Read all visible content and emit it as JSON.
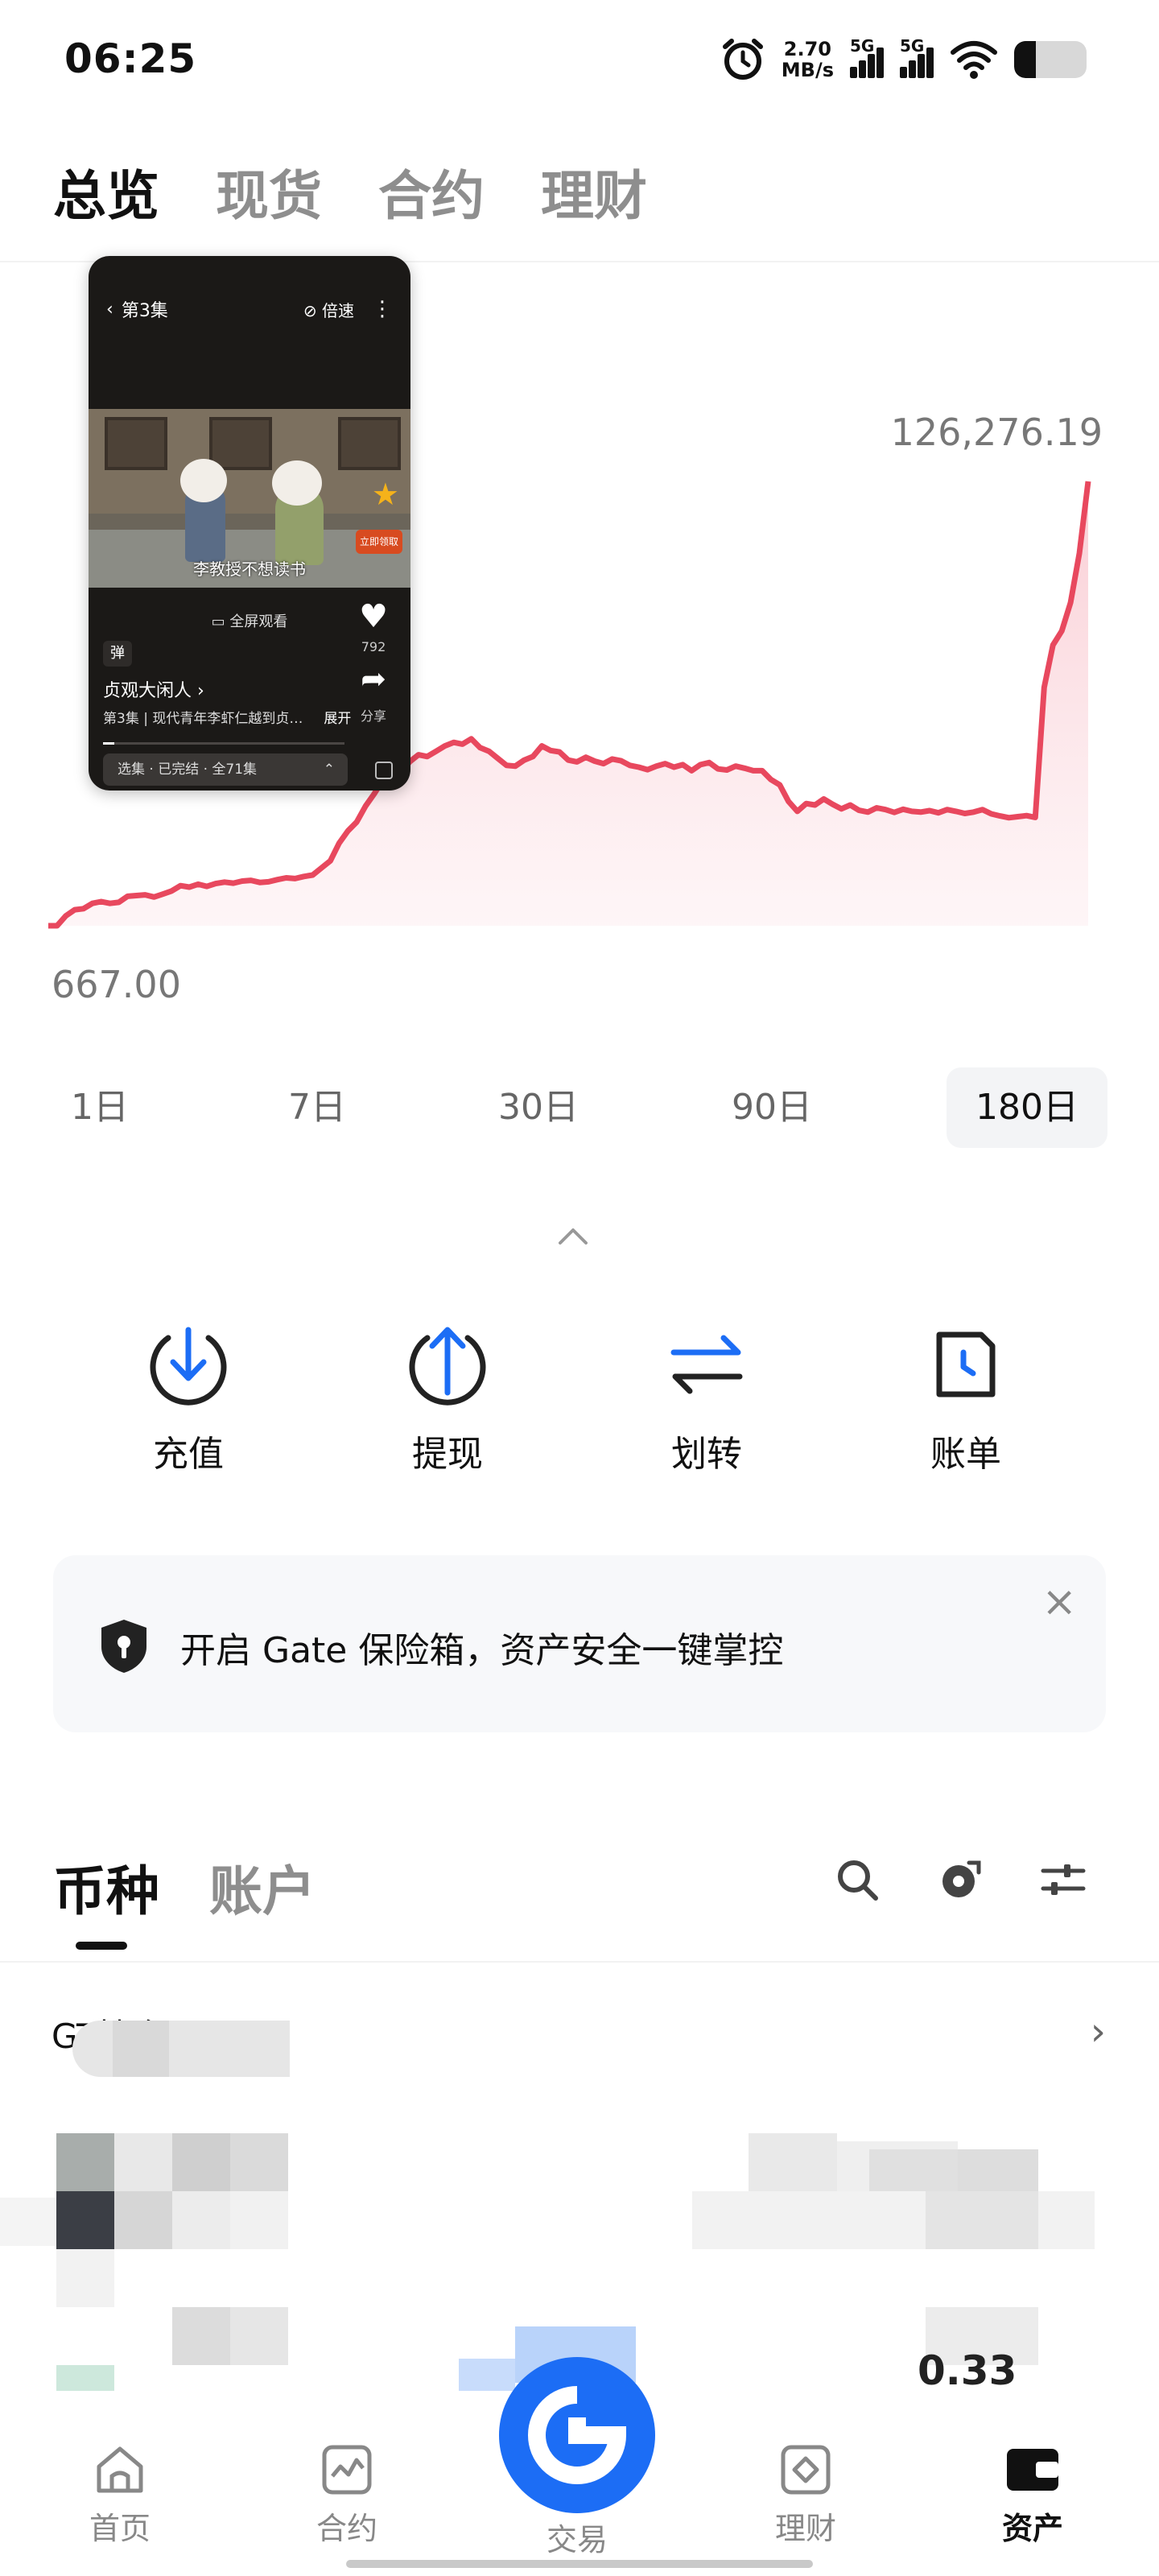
{
  "status_bar": {
    "time": "06:25",
    "speed_value": "2.70",
    "speed_unit": "MB/s",
    "sim1": "5G",
    "sim2": "5G",
    "icons": [
      "alarm-icon",
      "signal-icon",
      "wifi-icon",
      "battery-icon"
    ],
    "battery_level": 0.3
  },
  "top_tabs": [
    {
      "label": "总览",
      "active": true
    },
    {
      "label": "现货",
      "active": false
    },
    {
      "label": "合约",
      "active": false
    },
    {
      "label": "理财",
      "active": false
    }
  ],
  "chart_data": {
    "type": "area",
    "title": "",
    "xlabel": "",
    "ylabel": "",
    "max_label": "126,276.19",
    "min_label": "667.00",
    "ylim": [
      667.0,
      126276.19
    ],
    "color": "#e8485e",
    "fill_color": "#fde6ea",
    "series": [
      {
        "values": [
          667,
          667,
          3500,
          5200,
          5500,
          7000,
          7500,
          7000,
          7300,
          9000,
          9200,
          9400,
          8800,
          9600,
          10500,
          12000,
          11600,
          12400,
          11800,
          12600,
          13000,
          12700,
          13300,
          13500,
          12900,
          13100,
          13700,
          14200,
          14000,
          14600,
          15000,
          17000,
          19000,
          24000,
          27500,
          30000,
          34500,
          38000,
          42000,
          44500,
          43800,
          47000,
          49000,
          48500,
          50000,
          51500,
          52500,
          52000,
          53500,
          51000,
          50000,
          48000,
          46000,
          45800,
          47500,
          48500,
          51500,
          50200,
          49800,
          47500,
          47000,
          48300,
          47200,
          46500,
          47800,
          47300,
          46000,
          45500,
          44800,
          45800,
          46500,
          45500,
          46200,
          44500,
          46200,
          46800,
          45000,
          44700,
          45800,
          45200,
          44500,
          44500,
          42000,
          40500,
          35800,
          33000,
          35200,
          34800,
          36500,
          35000,
          33700,
          34800,
          33300,
          32800,
          34000,
          33500,
          32700,
          33600,
          33000,
          32800,
          33200,
          32600,
          33500,
          33000,
          32400,
          32800,
          33500,
          32300,
          31700,
          31200,
          31500,
          31800,
          31300,
          68000,
          80000,
          84000,
          92000,
          106000,
          126276.19
        ]
      }
    ]
  },
  "video_pip": {
    "episode_title": "第3集",
    "speed_label": "倍速",
    "subtitle": "李教授不想读书",
    "star_badge": "立即领取",
    "fullscreen_label": "全屏观看",
    "like_count": "792",
    "danmaku_label": "弹",
    "series_title": "贞观大闲人 ›",
    "share_label": "分享",
    "description": "第3集 | 现代青年李虾仁越到贞…",
    "expand_label": "展开",
    "episode_bar": "选集 · 已完结 · 全71集"
  },
  "range_tabs": [
    {
      "label": "1日",
      "active": false
    },
    {
      "label": "7日",
      "active": false
    },
    {
      "label": "30日",
      "active": false
    },
    {
      "label": "90日",
      "active": false
    },
    {
      "label": "180日",
      "active": true
    }
  ],
  "actions": [
    {
      "label": "充值",
      "icon": "deposit-icon"
    },
    {
      "label": "提现",
      "icon": "withdraw-icon"
    },
    {
      "label": "划转",
      "icon": "transfer-icon"
    },
    {
      "label": "账单",
      "icon": "bill-icon"
    }
  ],
  "banner": {
    "text": "开启 Gate 保险箱，资产安全一键掌控",
    "icon": "shield-icon",
    "close": "×"
  },
  "coin_tabs": [
    {
      "label": "币种",
      "active": true
    },
    {
      "label": "账户",
      "active": false
    }
  ],
  "coin_tools": [
    "search-icon",
    "hide-small-icon",
    "filter-icon"
  ],
  "gt_row": {
    "label": "GT持仓 0.00"
  },
  "obscured_value": "0.33",
  "bottom_nav": [
    {
      "label": "首页",
      "icon": "home-icon",
      "active": false
    },
    {
      "label": "合约",
      "icon": "futures-icon",
      "active": false
    },
    {
      "label": "交易",
      "icon": "trade-icon",
      "active": false
    },
    {
      "label": "理财",
      "icon": "earn-icon",
      "active": false
    },
    {
      "label": "资产",
      "icon": "wallet-icon",
      "active": true
    }
  ],
  "colors": {
    "accent": "#1c6df5",
    "chart_line": "#e8485e",
    "text": "#111111",
    "muted": "#8e8e8e"
  }
}
